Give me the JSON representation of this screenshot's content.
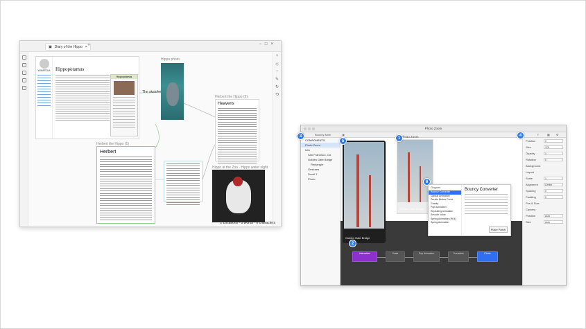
{
  "left_window": {
    "tab_title": "Diary of the Hippo",
    "status": "2 Locations · 0 words · 0 characters",
    "wiki_page_title": "Hippopotamus",
    "wiki_logo_text": "WIKIPEDIA",
    "infobox_title": "Hippopotamus",
    "hippo_caption": "Hippo photo",
    "herbert_caption": "Herbert the Hippo (1)",
    "herbert_title": "Herbert",
    "hiav_caption": "Herbert the Hippo (2)",
    "hiav_title": "Heavens",
    "photo_caption": "Hippo at the Zoo · Hippo water sight",
    "link_label": "The sketches",
    "right_tools": [
      "+",
      "◇",
      "−",
      "✎",
      "↻",
      "⟲"
    ]
  },
  "right_window": {
    "title": "Photo Zoom",
    "search": "Bouncy Anim",
    "layers_header": "COMPONENTS",
    "layers": [
      {
        "label": "Photo Zoom",
        "selected": true
      },
      {
        "label": "Info",
        "selected": false
      },
      {
        "label": "San Francisco, CA",
        "selected": false
      },
      {
        "label": "Golden Gate Bridge",
        "selected": false
      },
      {
        "label": "Rectangle",
        "selected": false
      },
      {
        "label": "Gestures",
        "selected": false
      },
      {
        "label": "Scroll 1",
        "selected": false
      },
      {
        "label": "Photo",
        "selected": false
      }
    ],
    "phone_caption": "Golden Gate Bridge",
    "phone_title": "Photo Zoom",
    "popup": {
      "list_header": "Origami",
      "items": [
        "Bouncy Converter",
        "Classic Animation",
        "Double Button Curve",
        "Gravity",
        "Pop Animation",
        "Repeating Animation",
        "Smooth Value",
        "Spring Animation (RK4)",
        "Spring Animation"
      ],
      "selected": "Bouncy Converter",
      "detail_title": "Bouncy Converter",
      "button": "Place Patch"
    },
    "inspector": [
      {
        "label": "Position",
        "value": "0"
      },
      {
        "label": "Size",
        "value": "375"
      },
      {
        "label": "Opacity",
        "value": "1"
      },
      {
        "label": "Rotation",
        "value": "0"
      },
      {
        "label": "Background",
        "value": ""
      },
      {
        "label": "Layout",
        "value": ""
      },
      {
        "label": "Scale",
        "value": "1"
      },
      {
        "label": "Alignment",
        "value": "Center"
      },
      {
        "label": "Spacing",
        "value": "0"
      },
      {
        "label": "Padding",
        "value": "0"
      },
      {
        "label": "Pos & Size",
        "value": ""
      },
      {
        "label": "Camera",
        "value": ""
      },
      {
        "label": "Position",
        "value": "Auto"
      },
      {
        "label": "Size",
        "value": "Auto"
      }
    ],
    "nodes": [
      "Interaction",
      "Scale",
      "Pop Animation",
      "Transition",
      "Photo"
    ]
  },
  "badges": [
    "1",
    "2",
    "3",
    "4",
    "5",
    "6"
  ],
  "colors": {
    "badge": "#2f7be8",
    "patch_bg": "#3a3a3a",
    "accent_purple": "#8e2fd0",
    "accent_blue": "#2f6ff0"
  }
}
